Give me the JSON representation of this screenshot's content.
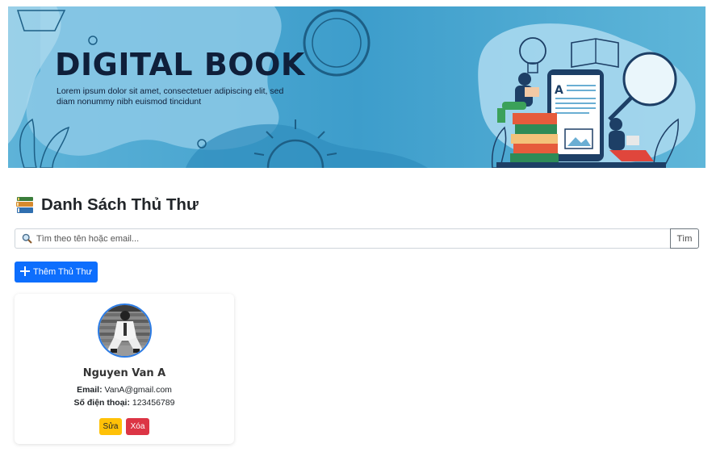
{
  "banner": {
    "title": "DIGITAL BOOK",
    "subtitle": "Lorem ipsum dolor sit amet, consectetuer adipiscing elit, sed diam nonummy nibh euismod tincidunt",
    "illustration_book_letter": "A"
  },
  "page": {
    "title": "Danh Sách Thủ Thư",
    "title_icon": "books-icon"
  },
  "search": {
    "placeholder": "Tìm theo tên hoặc email...",
    "value": "",
    "icon": "search-icon",
    "button_label": "Tìm"
  },
  "toolbar": {
    "add_label": "Thêm Thủ Thư",
    "add_icon": "plus-icon"
  },
  "librarians": [
    {
      "name": "Nguyen Van A",
      "email_label": "Email:",
      "email": "VanA@gmail.com",
      "phone_label": "Số điện thoại:",
      "phone": "123456789",
      "edit_label": "Sửa",
      "delete_label": "Xóa"
    }
  ],
  "colors": {
    "primary": "#0d6efd",
    "warning": "#ffc107",
    "danger": "#dc3545",
    "banner_blue": "#3fa1cc",
    "avatar_border": "#2b7be4"
  }
}
